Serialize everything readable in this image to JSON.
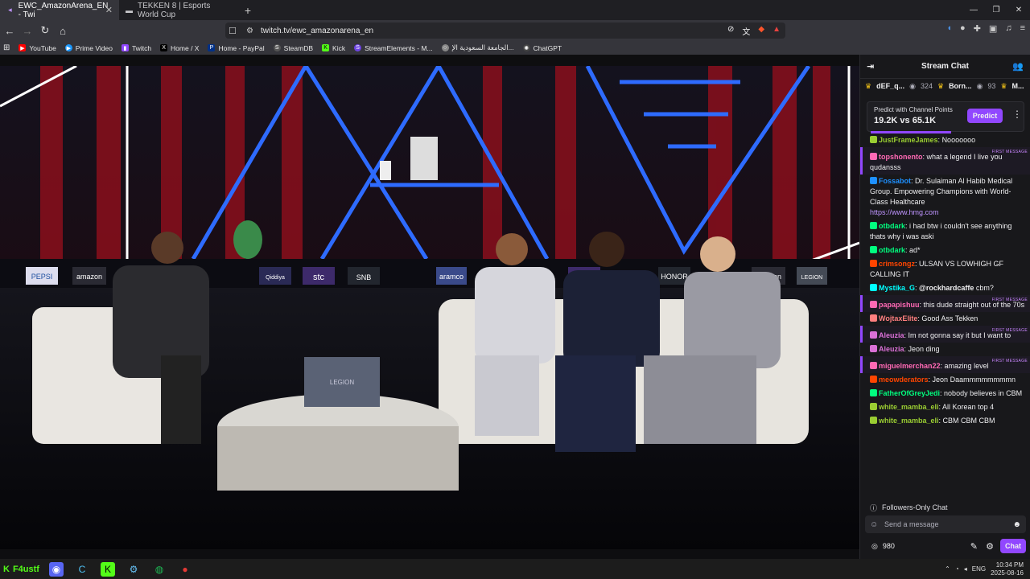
{
  "browser": {
    "tabs": [
      {
        "title": "EWC_AmazonArena_EN - Twi",
        "active": true
      },
      {
        "title": "TEKKEN 8 | Esports World Cup",
        "active": false
      }
    ],
    "url": "twitch.tv/ewc_amazonarena_en",
    "bookmarks": [
      "YouTube",
      "Prime Video",
      "Twitch",
      "Home / X",
      "Home - PayPal",
      "SteamDB",
      "Kick",
      "StreamElements - M...",
      "الجامعة السعودية الإ...",
      "ChatGPT"
    ]
  },
  "stage": {
    "panels": [
      "PEPSI",
      "amazon",
      "aramco",
      "Qiddiya",
      "stc",
      "SNB",
      "aramco",
      "stc",
      "HONOR",
      "amazon",
      "LEGION"
    ],
    "laptop": "LEGION"
  },
  "chat": {
    "title": "Stream Chat",
    "leaders": [
      {
        "name": "dEF_q...",
        "count": "324"
      },
      {
        "name": "Born...",
        "count": "93"
      },
      {
        "name": "M..."
      }
    ],
    "predict": {
      "label": "Predict with Channel Points",
      "value": "19.2K vs 65.1K",
      "button": "Predict"
    },
    "messages": [
      {
        "user": "JustFrameJames",
        "color": "#9acd32",
        "text": "Nooooooo",
        "first": false
      },
      {
        "user": "topshonento",
        "color": "#ff69b4",
        "text": "what a legend I live you qudansss",
        "first": true
      },
      {
        "user": "Fossabot",
        "color": "#1e90ff",
        "text": "Dr. Sulaiman Al Habib Medical Group. Empowering Champions with World-Class Healthcare",
        "link": "https://www.hmg.com",
        "first": false
      },
      {
        "user": "otbdark",
        "color": "#00ff7f",
        "text": "i had btw i couldn't see anything thats why i was aski",
        "first": false
      },
      {
        "user": "otbdark",
        "color": "#00ff7f",
        "text": "ad*",
        "first": false
      },
      {
        "user": "crimsongz",
        "color": "#ff4500",
        "text": "ULSAN VS LOWHIGH GF CALLING IT",
        "first": false
      },
      {
        "user": "Mystika_G",
        "color": "#00ffff",
        "text": "cbm?",
        "mention": "@rockhardcaffe",
        "first": false
      },
      {
        "user": "papapishuu",
        "color": "#ff69b4",
        "text": "this dude straight out of the 70s",
        "first": true
      },
      {
        "user": "WojtaxElite",
        "color": "#ff7f7f",
        "text": "Good Ass Tekken",
        "first": false
      },
      {
        "user": "Aleuzia",
        "color": "#da70d6",
        "text": "Im not gonna say it but I want to",
        "first": true
      },
      {
        "user": "Aleuzia",
        "color": "#da70d6",
        "text": "Jeon ding",
        "first": false
      },
      {
        "user": "miguelmerchan22",
        "color": "#ff69b4",
        "text": "amazing level",
        "first": true
      },
      {
        "user": "meowderators",
        "color": "#ff4500",
        "text": "Jeon Daammmmmmmmn",
        "first": false
      },
      {
        "user": "FatherOfGreyJedi",
        "color": "#00ff7f",
        "text": "nobody believes in CBM",
        "first": false
      },
      {
        "user": "white_mamba_eli",
        "color": "#9acd32",
        "text": "All Korean top 4",
        "first": false
      },
      {
        "user": "white_mamba_eli",
        "color": "#9acd32",
        "text": "CBM CBM CBM",
        "first": false
      }
    ],
    "first_flag": "FIRST MESSAGE",
    "followers_only": "Followers-Only Chat",
    "placeholder": "Send a message",
    "points": "980",
    "chat_button": "Chat"
  },
  "taskbar": {
    "user": "F4ustf",
    "lang": "ENG",
    "time": "10:34 PM",
    "date": "2025-08-16"
  },
  "colors": {
    "accent": "#9147ff",
    "kick": "#53fc18"
  }
}
